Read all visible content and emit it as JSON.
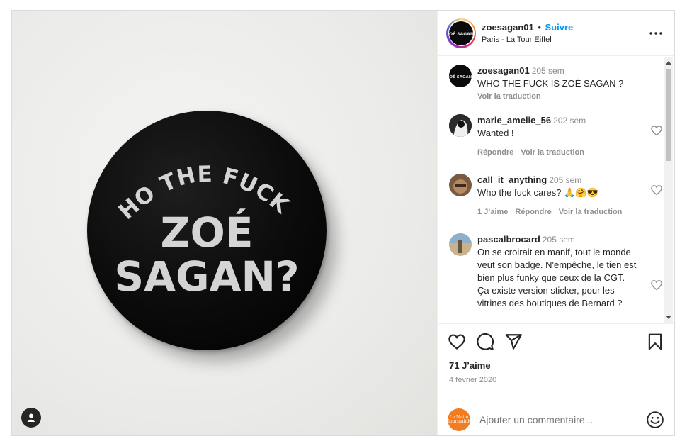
{
  "post": {
    "author": "zoesagan01",
    "separator": "•",
    "follow_label": "Suivre",
    "location": "Paris - La Tour Eiffel",
    "more_label": "•••",
    "image": {
      "badge_line1": "WHO THE FUCK IS",
      "badge_line2": "ZOÉ",
      "badge_line3": "SAGAN?",
      "avatar_badge_text": "ZOÉ SAGAN?"
    }
  },
  "comments": [
    {
      "user": "zoesagan01",
      "time": "205 sem",
      "text": "WHO THE FUCK IS ZOÉ SAGAN ?",
      "actions": [
        "Voir la traduction"
      ]
    },
    {
      "user": "marie_amelie_56",
      "time": "202 sem",
      "text": "Wanted !",
      "actions": [
        "Répondre",
        "Voir la traduction"
      ]
    },
    {
      "user": "call_it_anything",
      "time": "205 sem",
      "text": "Who the fuck cares? 🙏🤗😎",
      "actions": [
        "1 J’aime",
        "Répondre",
        "Voir la traduction"
      ]
    },
    {
      "user": "pascalbrocard",
      "time": "205 sem",
      "text": "On se croirait en manif, tout le monde veut son badge. N'empêche, le tien est bien plus funky que ceux de la CGT. Ça existe version sticker, pour les vitrines des boutiques de Bernard ?",
      "actions": []
    }
  ],
  "footer": {
    "likes": "71 J’aime",
    "date": "4 février 2020",
    "comment_placeholder": "Ajouter un commentaire...",
    "my_avatar_text": "Le Maijn Gourmande"
  },
  "colors": {
    "accent": "#0095f6",
    "text": "#262626",
    "muted": "#8e8e8e",
    "border": "#dbdbdb"
  }
}
